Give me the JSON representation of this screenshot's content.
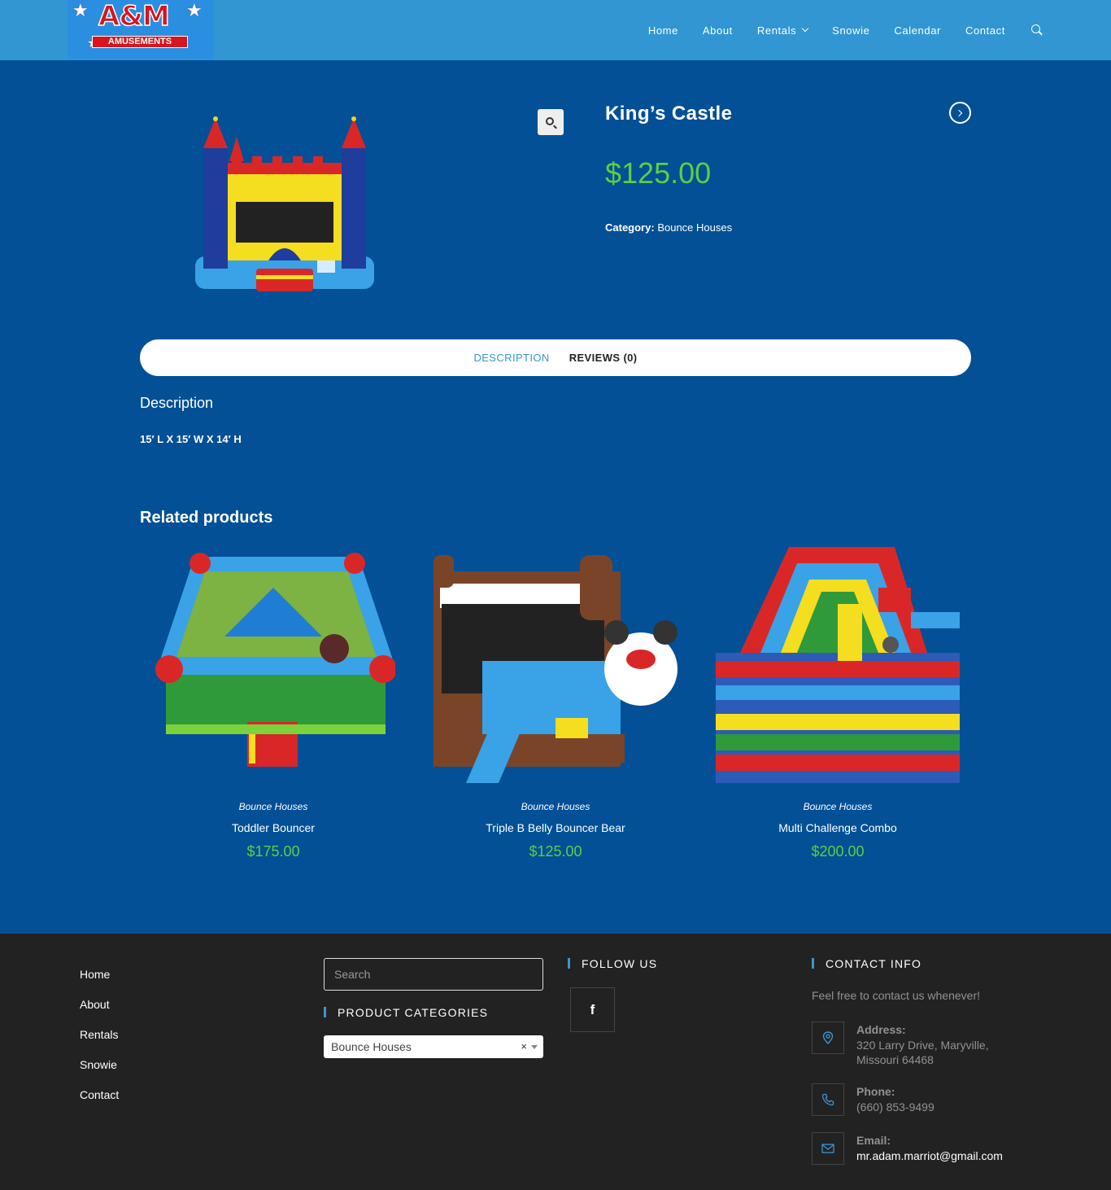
{
  "header": {
    "logo": {
      "brand": "A&M",
      "ribbon": "AMUSEMENTS"
    },
    "nav": [
      {
        "label": "Home"
      },
      {
        "label": "About"
      },
      {
        "label": "Rentals"
      },
      {
        "label": "Snowie"
      },
      {
        "label": "Calendar"
      },
      {
        "label": "Contact"
      }
    ],
    "search_icon": "search-icon"
  },
  "product": {
    "title": "King’s Castle",
    "price": "$125.00",
    "category_label": "Category:",
    "category_value": "Bounce Houses",
    "zoom_icon": "magnifier-icon",
    "next_icon": "chevron-right-circle-icon"
  },
  "tabs": [
    {
      "label": "DESCRIPTION",
      "active": true
    },
    {
      "label": "REVIEWS (0)",
      "active": false
    }
  ],
  "description": {
    "heading": "Description",
    "text": "15′ L X 15′ W X 14′ H"
  },
  "related": {
    "heading": "Related products",
    "items": [
      {
        "category": "Bounce Houses",
        "name": "Toddler Bouncer",
        "price": "$175.00"
      },
      {
        "category": "Bounce Houses",
        "name": "Triple B Belly Bouncer Bear",
        "price": "$125.00"
      },
      {
        "category": "Bounce Houses",
        "name": "Multi Challenge Combo",
        "price": "$200.00"
      }
    ]
  },
  "footer": {
    "nav": [
      {
        "label": "Home"
      },
      {
        "label": "About"
      },
      {
        "label": "Rentals"
      },
      {
        "label": "Snowie"
      },
      {
        "label": "Contact"
      }
    ],
    "search_placeholder": "Search",
    "product_categories_title": "PRODUCT CATEGORIES",
    "product_categories_selected": "Bounce Houses",
    "follow_title": "FOLLOW US",
    "contact_title": "CONTACT INFO",
    "contact_intro": "Feel free to contact us whenever!",
    "address_label": "Address:",
    "address_value": "320 Larry Drive, Maryville, Missouri 64468",
    "phone_label": "Phone:",
    "phone_value": "(660) 853-9499",
    "email_label": "Email:",
    "email_value": "mr.adam.marriot@gmail.com"
  },
  "colors": {
    "header_bg": "#3196d2",
    "page_bg": "#035096",
    "price_green": "#5fcd43",
    "accent_blue": "#3b95d0",
    "footer_bg": "#222222"
  }
}
